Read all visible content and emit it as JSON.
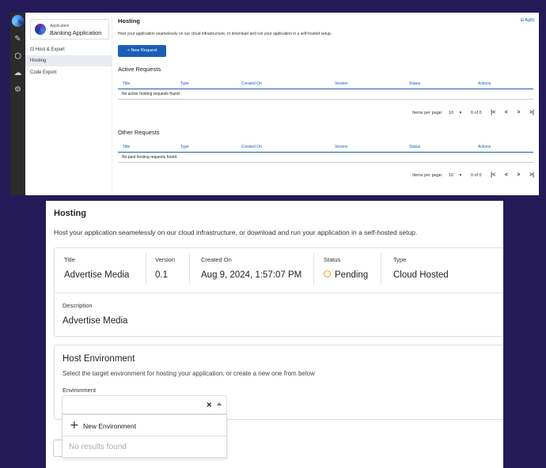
{
  "top": {
    "app": {
      "subtitle": "Application",
      "name": "Banking Application"
    },
    "sidebar": {
      "items": [
        {
          "label": "Host & Export",
          "icon": "host-export-icon"
        },
        {
          "label": "Hosting"
        },
        {
          "label": "Code Export"
        }
      ]
    },
    "rail_icons": [
      "pencil-icon",
      "box-icon",
      "cloud-icon",
      "gear-icon"
    ],
    "user": "AgBl",
    "title": "Hosting",
    "description": "Host your application seamelessly on our cloud infrastructure, or download and run your application in a self-hosted setup.",
    "new_request_label": "+   New Request",
    "active_section": "Active Requests",
    "other_section": "Other Requests",
    "columns": [
      "Title",
      "Type",
      "Created On",
      "Version",
      "Status",
      "Actions"
    ],
    "active_empty": "No active hosting requests found",
    "other_empty": "No past hosting requests found",
    "pager": {
      "items_label": "Items per page:",
      "per_page": "10",
      "range": "0 of 0",
      "first": "|<",
      "prev": "<",
      "next": ">",
      "last": ">|"
    }
  },
  "bottom": {
    "title": "Hosting",
    "description": "Host your application seamelessly on our cloud infrastructure, or download and run your application in a self-hosted setup.",
    "details": {
      "title_label": "Title",
      "title_value": "Advertise Media",
      "version_label": "Version",
      "version_value": "0.1",
      "created_label": "Created On",
      "created_value": "Aug 9, 2024, 1:57:07 PM",
      "status_label": "Status",
      "status_value": "Pending",
      "status_color": "#f0a500",
      "type_label": "Type",
      "type_value": "Cloud Hosted",
      "description_label": "Description",
      "description_value": "Advertise Media"
    },
    "environment": {
      "heading": "Host Environment",
      "description": "Select the target environment for hosting your application, or create a new one from below",
      "label": "Environment",
      "clear_glyph": "✕",
      "new_option": "New Environment",
      "no_results": "No results found"
    }
  },
  "colors": {
    "primary": "#1a5fb4",
    "background": "#241a57",
    "rail": "#2b2b2b"
  }
}
